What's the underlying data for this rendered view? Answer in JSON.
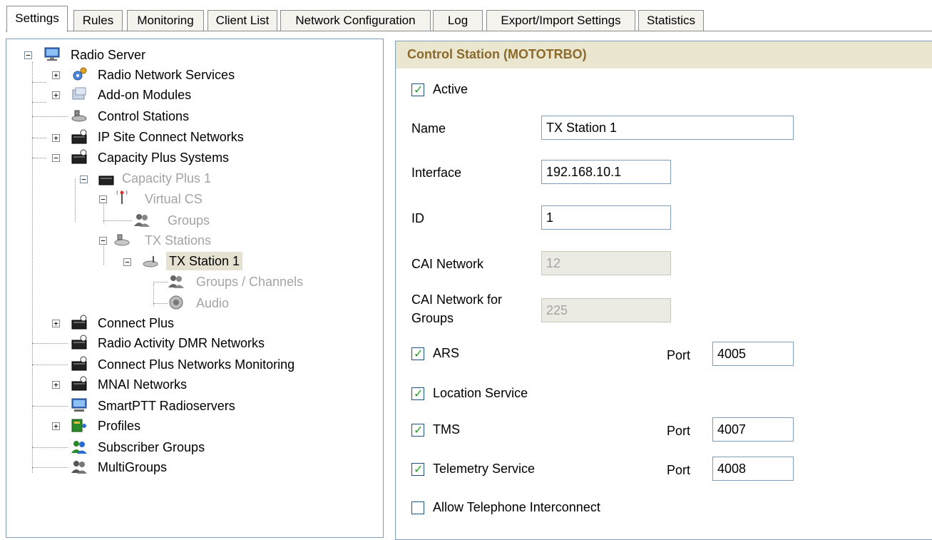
{
  "tabs": [
    "Settings",
    "Rules",
    "Monitoring",
    "Client List",
    "Network Configuration",
    "Log",
    "Export/Import Settings",
    "Statistics"
  ],
  "tree": {
    "radio_server": "Radio Server",
    "radio_network_services": "Radio Network Services",
    "addon_modules": "Add-on Modules",
    "control_stations": "Control Stations",
    "ip_site_connect": "IP Site Connect Networks",
    "capacity_plus_systems": "Capacity Plus Systems",
    "capacity_plus_1": "Capacity Plus 1",
    "virtual_cs": "Virtual CS",
    "groups": "Groups",
    "tx_stations": "TX Stations",
    "tx_station_1": "TX Station 1",
    "groups_channels": "Groups / Channels",
    "audio": "Audio",
    "connect_plus": "Connect Plus",
    "radio_activity_dmr": "Radio Activity DMR Networks",
    "connect_plus_monitoring": "Connect Plus Networks Monitoring",
    "mnai_networks": "MNAI Networks",
    "smartptt_radioservers": "SmartPTT Radioservers",
    "profiles": "Profiles",
    "subscriber_groups": "Subscriber Groups",
    "multigroups": "MultiGroups"
  },
  "panel": {
    "title": "Control Station (MOTOTRBO)",
    "active_label": "Active",
    "active_checked": true,
    "name_label": "Name",
    "name_value": "TX Station 1",
    "interface_label": "Interface",
    "interface_value": "192.168.10.1",
    "id_label": "ID",
    "id_value": "1",
    "cai_network_label": "CAI Network",
    "cai_network_value": "12",
    "cai_groups_label_line1": "CAI Network for",
    "cai_groups_label_line2": "Groups",
    "cai_groups_value": "225",
    "ars_label": "ARS",
    "ars_checked": true,
    "port_label": "Port",
    "ars_port": "4005",
    "location_label": "Location Service",
    "location_checked": true,
    "tms_label": "TMS",
    "tms_checked": true,
    "tms_port": "4007",
    "telemetry_label": "Telemetry Service",
    "telemetry_checked": true,
    "telemetry_port": "4008",
    "telephone_label": "Allow Telephone Interconnect",
    "telephone_checked": false
  },
  "colors": {
    "header_bg": "#ebe6d0",
    "header_text": "#8b6a2b",
    "check_green": "#21a121",
    "selection_bg": "#e6e2d1"
  }
}
